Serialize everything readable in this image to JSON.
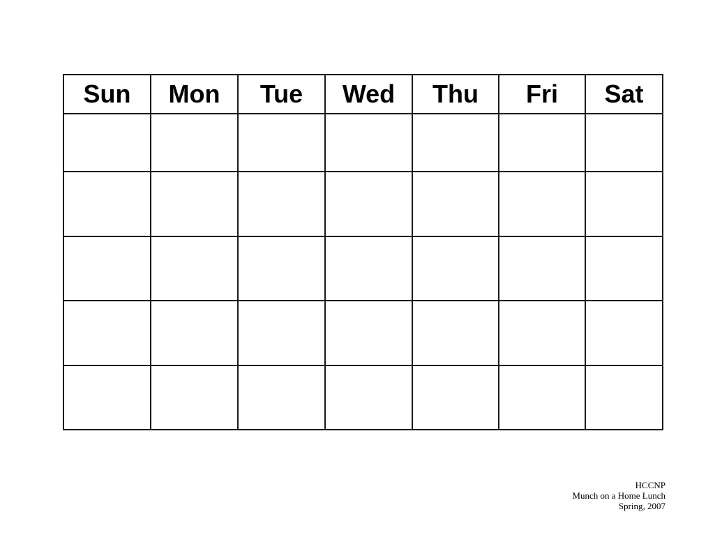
{
  "calendar": {
    "days": [
      "Sun",
      "Mon",
      "Tue",
      "Wed",
      "Thu",
      "Fri",
      "Sat"
    ],
    "weeks": 5
  },
  "footer": {
    "lines": [
      "HCCNP",
      "Munch on a Home Lunch",
      "Spring, 2007"
    ]
  }
}
